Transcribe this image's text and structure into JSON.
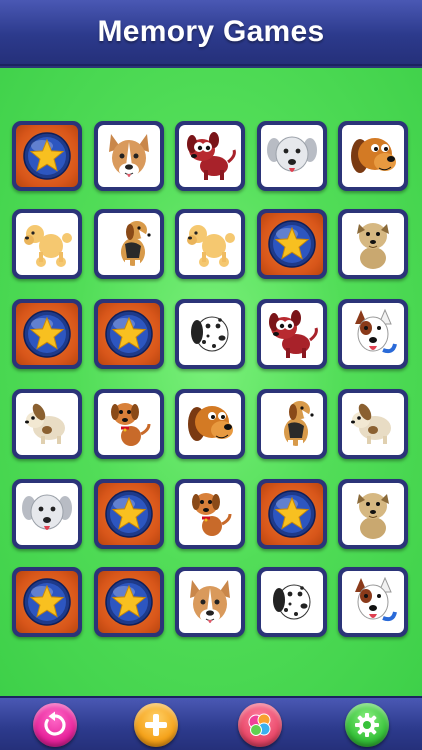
{
  "header": {
    "title": "Memory Games"
  },
  "board": {
    "rows": 6,
    "cols": 5,
    "cards": [
      "star-card-back",
      "pitbull-dog",
      "red-dog",
      "gray-dog",
      "brown-hound",
      "poodle-dog",
      "beagle-dog",
      "poodle-dog",
      "star-card-back",
      "tan-terrier",
      "star-card-back",
      "star-card-back",
      "dalmatian-dog",
      "red-dog",
      "bull-terrier",
      "floppy-dog",
      "red-puppy",
      "brown-hound",
      "beagle-dog",
      "floppy-dog",
      "gray-dog",
      "star-card-back",
      "red-puppy",
      "star-card-back",
      "tan-terrier",
      "star-card-back",
      "star-card-back",
      "pitbull-dog",
      "dalmatian-dog",
      "bull-terrier"
    ]
  },
  "footer": {
    "buttons": [
      {
        "name": "restart-button",
        "icon": "refresh-icon",
        "color": "#e8249c"
      },
      {
        "name": "add-button",
        "icon": "plus-icon",
        "color": "#f5a21a"
      },
      {
        "name": "game-center-button",
        "icon": "game-center-icon",
        "color": "#e94a6a"
      },
      {
        "name": "settings-button",
        "icon": "gear-icon",
        "color": "#37c23a"
      }
    ]
  },
  "colors": {
    "header": "#2c3a8c",
    "board_green": "#52dd58",
    "card_border": "#2b3478",
    "card_back_orange": "#d8561a",
    "star_gold": "#f8c020"
  }
}
